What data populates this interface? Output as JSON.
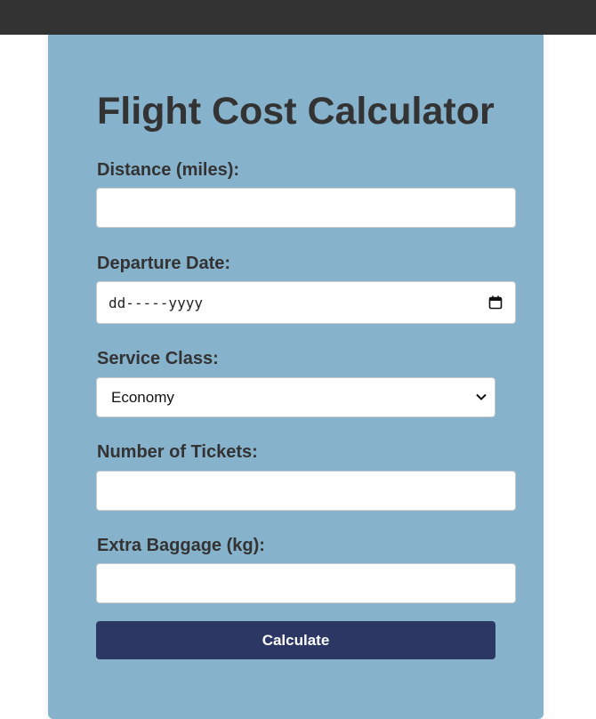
{
  "form": {
    "title": "Flight Cost Calculator",
    "distance_label": "Distance (miles):",
    "departure_label": "Departure Date:",
    "date_placeholder": "dd-----yyyy",
    "service_class_label": "Service Class:",
    "service_class_selected": "Economy",
    "tickets_label": "Number of Tickets:",
    "baggage_label": "Extra Baggage (kg):",
    "calculate_label": "Calculate"
  },
  "colors": {
    "topbar": "#333333",
    "card_background": "#86b2cb",
    "button_background": "#2c3863",
    "text": "#333333"
  }
}
